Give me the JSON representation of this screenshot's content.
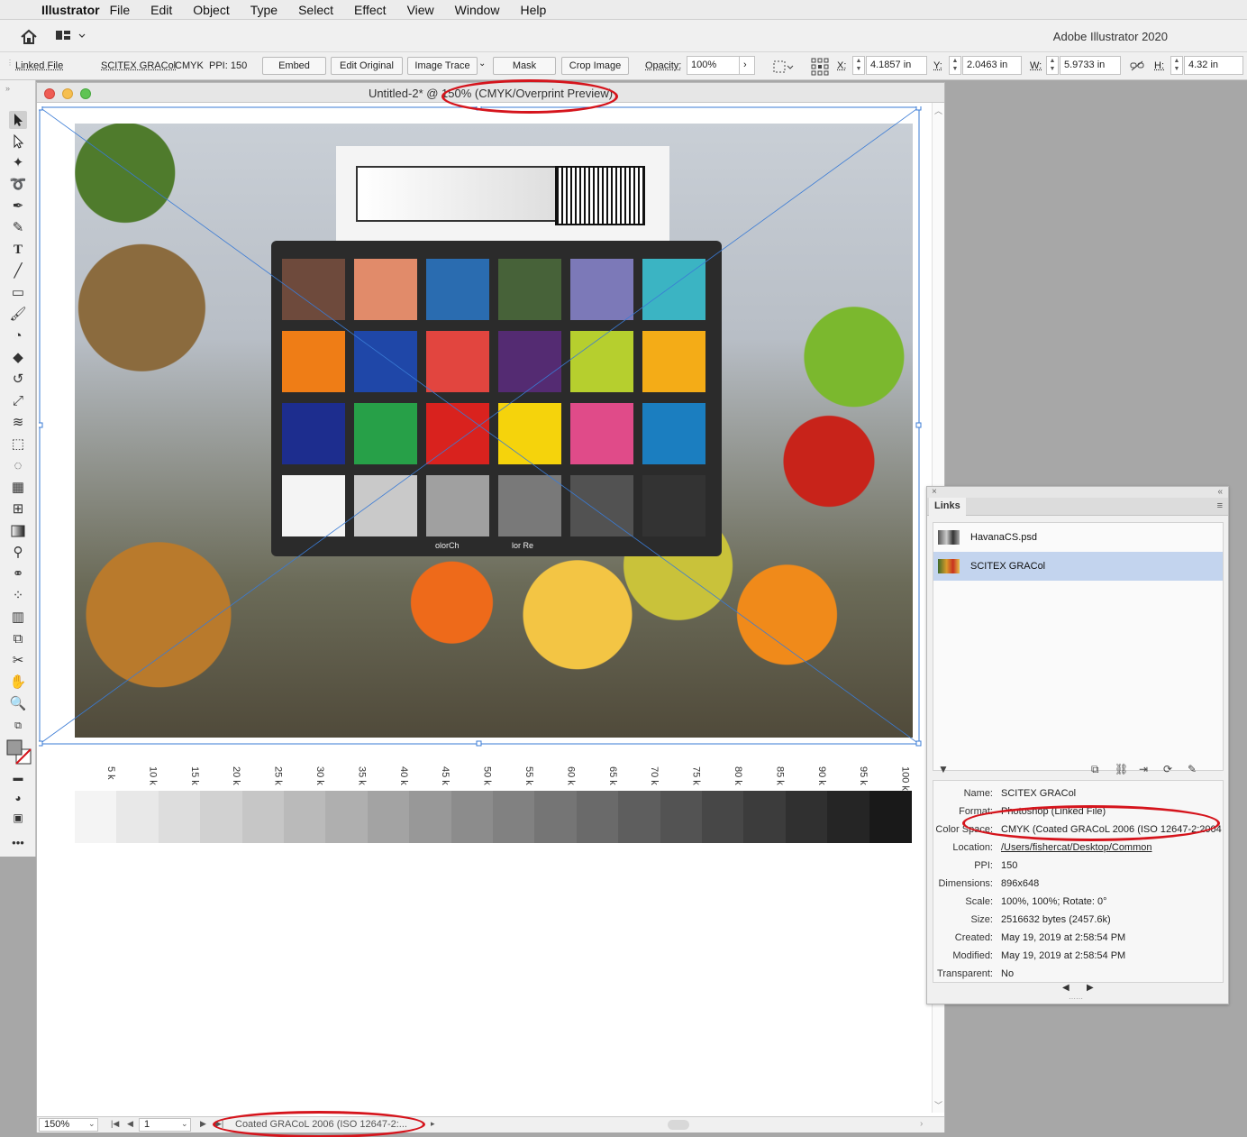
{
  "menubar": {
    "app": "Illustrator",
    "items": [
      "File",
      "Edit",
      "Object",
      "Type",
      "Select",
      "Effect",
      "View",
      "Window",
      "Help"
    ]
  },
  "appbar": {
    "title": "Adobe Illustrator 2020"
  },
  "control_bar": {
    "linked_file": "Linked File",
    "file_name": "SCITEX GRACol",
    "color_mode": "CMYK",
    "ppi": "PPI: 150",
    "embed": "Embed",
    "edit_original": "Edit Original",
    "image_trace": "Image Trace",
    "mask": "Mask",
    "crop_image": "Crop Image",
    "opacity_label": "Opacity:",
    "opacity_value": "100%",
    "x_label": "X:",
    "x_value": "4.1857 in",
    "y_label": "Y:",
    "y_value": "2.0463 in",
    "w_label": "W:",
    "w_value": "5.9733 in",
    "h_label": "H:",
    "h_value": "4.32 in"
  },
  "document": {
    "title": "Untitled-2* @ 150% (CMYK/Overprint Preview)",
    "photo_text_left": "olorCh",
    "photo_text_right": "lor Re",
    "scale_labels": [
      "5 k",
      "10 k",
      "15 k",
      "20 k",
      "25 k",
      "30 k",
      "35 k",
      "40 k",
      "45 k",
      "50 k",
      "55 k",
      "60 k",
      "65 k",
      "70 k",
      "75 k",
      "80 k",
      "85 k",
      "90 k",
      "95 k",
      "100 k"
    ],
    "scale_percent": [
      5,
      10,
      15,
      20,
      25,
      30,
      35,
      40,
      45,
      50,
      55,
      60,
      65,
      70,
      75,
      80,
      85,
      90,
      95,
      100
    ],
    "status": {
      "zoom": "150%",
      "page": "1",
      "profile": "Coated GRACoL 2006 (ISO 12647-2:..."
    }
  },
  "links_panel": {
    "tab": "Links",
    "items": [
      {
        "name": "HavanaCS.psd",
        "selected": false
      },
      {
        "name": "SCITEX GRACol",
        "selected": true
      }
    ],
    "info": [
      {
        "key": "Name:",
        "value": "SCITEX GRACol"
      },
      {
        "key": "Format:",
        "value": "Photoshop (Linked File)"
      },
      {
        "key": "Color Space:",
        "value": "CMYK (Coated GRACoL 2006 (ISO 12647-2:2004"
      },
      {
        "key": "Location:",
        "value": "/Users/fishercat/Desktop/Common"
      },
      {
        "key": "PPI:",
        "value": "150"
      },
      {
        "key": "Dimensions:",
        "value": "896x648"
      },
      {
        "key": "Scale:",
        "value": "100%, 100%; Rotate: 0°"
      },
      {
        "key": "Size:",
        "value": "2516632 bytes (2457.6k)"
      },
      {
        "key": "Created:",
        "value": "May 19, 2019 at 2:58:54 PM"
      },
      {
        "key": "Modified:",
        "value": "May 19, 2019 at 2:58:54 PM"
      },
      {
        "key": "Transparent:",
        "value": "No"
      }
    ]
  },
  "colors": {
    "annotation_red": "#d5141c",
    "selection_blue": "#3a7bd5",
    "selected_row": "#c3d4ee"
  }
}
